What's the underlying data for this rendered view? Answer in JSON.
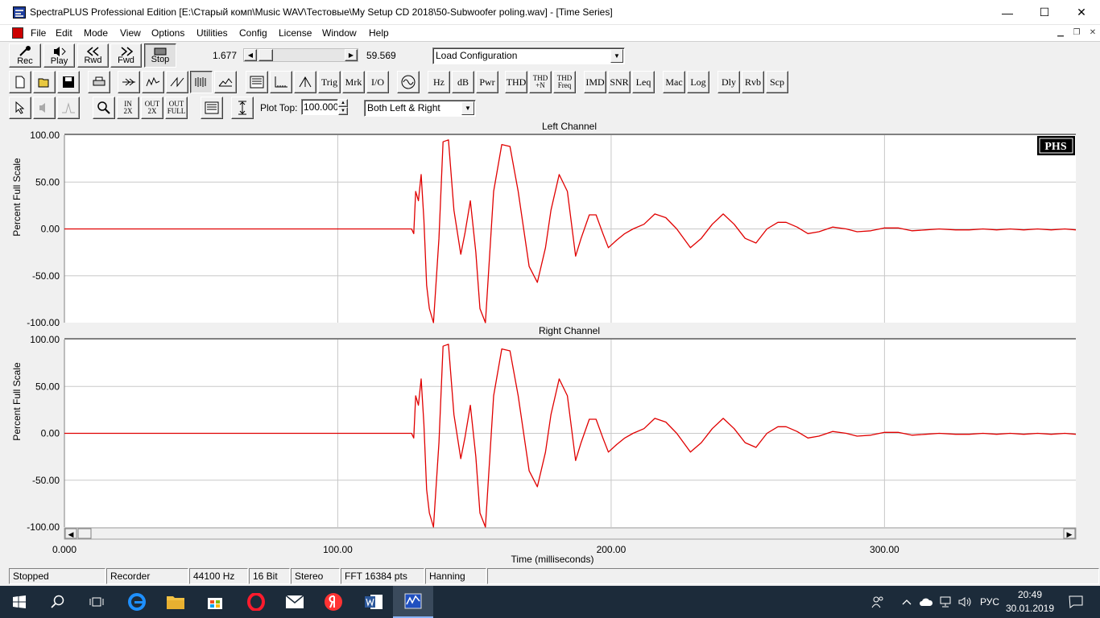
{
  "window": {
    "title": "SpectraPLUS Professional Edition [E:\\Старый комп\\Music WAV\\Тестовые\\My Setup CD 2018\\50-Subwoofer  poling.wav] - [Time Series]",
    "minimize": "—",
    "maximize": "☐",
    "close": "✕"
  },
  "menu": [
    "File",
    "Edit",
    "Mode",
    "View",
    "Options",
    "Utilities",
    "Config",
    "License",
    "Window",
    "Help"
  ],
  "transport": {
    "rec": "Rec",
    "play": "Play",
    "rwd": "Rwd",
    "fwd": "Fwd",
    "stop": "Stop",
    "time_start": "1.677",
    "time_end": "59.569",
    "config_select": "Load Configuration"
  },
  "toolbar2": {
    "trig": "Trig",
    "mrk": "Mrk",
    "io": "I/O",
    "hz": "Hz",
    "db": "dB",
    "pwr": "Pwr",
    "thd": "THD",
    "thdn_1": "THD",
    "thdn_2": "+N",
    "thdf_1": "THD",
    "thdf_2": "Freq",
    "imd": "IMD",
    "snr": "SNR",
    "leq": "Leq",
    "mac": "Mac",
    "log": "Log",
    "dly": "Dly",
    "rvb": "Rvb",
    "scp": "Scp"
  },
  "toolbar3": {
    "zin_1": "IN",
    "zin_2": "2X",
    "zout_1": "OUT",
    "zout_2": "2X",
    "zfull_1": "OUT",
    "zfull_2": "FULL",
    "plot_top_label": "Plot Top:",
    "plot_top_value": "100.000",
    "channel_select": "Both Left & Right"
  },
  "plots": {
    "left_title": "Left Channel",
    "right_title": "Right Channel",
    "badge": "PHS",
    "ylabel": "Percent Full Scale",
    "xlabel": "Time (milliseconds)",
    "y_ticks": [
      "100.00",
      "50.00",
      "0.00",
      "-50.00",
      "-100.00"
    ],
    "x_ticks": [
      "0.000",
      "100.00",
      "200.00",
      "300.00"
    ],
    "scroll_left": "◀",
    "scroll_right": "▶"
  },
  "chart_data": {
    "type": "line",
    "xlabel": "Time (milliseconds)",
    "ylabel": "Percent Full Scale",
    "xlim": [
      0,
      370
    ],
    "ylim": [
      -100,
      100
    ],
    "grid": true,
    "series_color": "#e00000",
    "channels": [
      "Left Channel",
      "Right Channel"
    ],
    "x": [
      0,
      127,
      127.8,
      128.5,
      129.5,
      130.5,
      131.5,
      132.5,
      133.5,
      135,
      137,
      138.5,
      140.5,
      142.5,
      145,
      146.5,
      148.5,
      150.5,
      152,
      154,
      157,
      160,
      163,
      166,
      170,
      173,
      176,
      178,
      181,
      184,
      187,
      189,
      192,
      194.5,
      197,
      199,
      202,
      205,
      208,
      212,
      216,
      220,
      224,
      229,
      233,
      237,
      241,
      245,
      249,
      253,
      257,
      261,
      264,
      268,
      272,
      276,
      281,
      286,
      290,
      295,
      300,
      305,
      310,
      315,
      320,
      326,
      331,
      336,
      341,
      346,
      351,
      356,
      361,
      366,
      370
    ],
    "y": [
      0,
      0,
      -5,
      40,
      30,
      58,
      10,
      -60,
      -85,
      -100,
      -10,
      93,
      95,
      20,
      -27,
      -5,
      30,
      -25,
      -85,
      -100,
      40,
      90,
      88,
      40,
      -40,
      -57,
      -20,
      20,
      58,
      40,
      -29,
      -10,
      15,
      15,
      -5,
      -20,
      -12,
      -5,
      0,
      5,
      16,
      12,
      0,
      -20,
      -10,
      5,
      16,
      5,
      -10,
      -15,
      0,
      7,
      7,
      2,
      -5,
      -3,
      2,
      0,
      -3,
      -2,
      1,
      1,
      -2,
      -1,
      0,
      -1,
      -1,
      0,
      -1,
      0,
      -1,
      0,
      -1,
      0,
      -1
    ]
  },
  "status": [
    "Stopped",
    "Recorder",
    "44100 Hz",
    "16 Bit",
    "Stereo",
    "FFT 16384 pts",
    "Hanning"
  ],
  "taskbar": {
    "lang": "РУС",
    "time": "20:49",
    "date": "30.01.2019"
  }
}
